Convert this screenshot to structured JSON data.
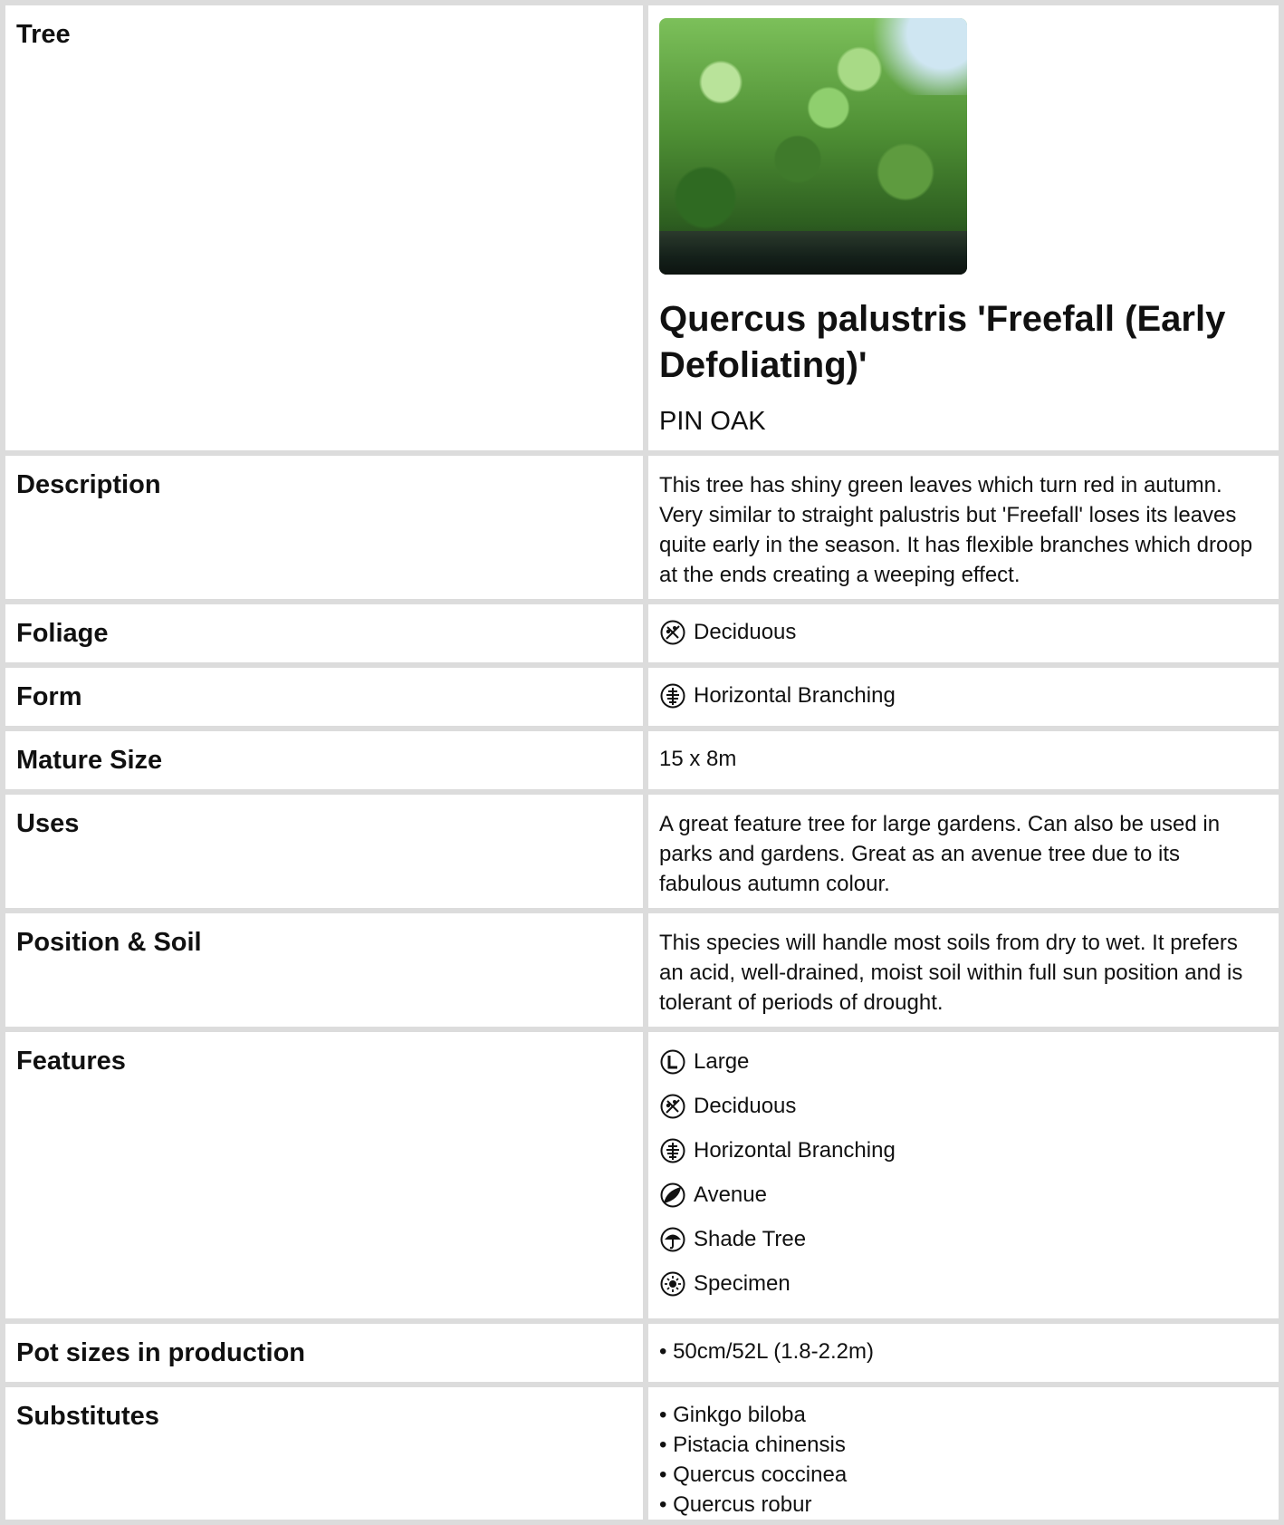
{
  "tree": {
    "label": "Tree",
    "name": "Quercus palustris 'Freefall (Early Defoliating)'",
    "common_name": "PIN OAK"
  },
  "description": {
    "label": "Description",
    "text": "This tree has shiny green leaves which turn red in autumn. Very similar to straight palustris but 'Freefall' loses its leaves quite early in the season. It has flexible branches which droop at the ends creating a weeping effect."
  },
  "foliage": {
    "label": "Foliage",
    "value": "Deciduous",
    "icon": "deciduous-icon"
  },
  "form": {
    "label": "Form",
    "value": "Horizontal Branching",
    "icon": "horizontal-branching-icon"
  },
  "mature_size": {
    "label": "Mature Size",
    "value": "15 x 8m"
  },
  "uses": {
    "label": "Uses",
    "text": "A great feature tree for large gardens. Can also be used in parks and gardens. Great as an avenue tree due to its fabulous autumn colour."
  },
  "position_soil": {
    "label": "Position & Soil",
    "text": "This species will handle most soils from dry to wet. It prefers an acid, well-drained, moist soil within full sun position and is tolerant of periods of drought."
  },
  "features": {
    "label": "Features",
    "items": [
      {
        "label": "Large",
        "icon": "large-icon"
      },
      {
        "label": "Deciduous",
        "icon": "deciduous-icon"
      },
      {
        "label": "Horizontal Branching",
        "icon": "horizontal-branching-icon"
      },
      {
        "label": "Avenue",
        "icon": "avenue-icon"
      },
      {
        "label": "Shade Tree",
        "icon": "shade-tree-icon"
      },
      {
        "label": "Specimen",
        "icon": "specimen-icon"
      }
    ]
  },
  "pot_sizes": {
    "label": "Pot sizes in production",
    "items": [
      "• 50cm/52L (1.8-2.2m)"
    ]
  },
  "substitutes": {
    "label": "Substitutes",
    "items": [
      "• Ginkgo biloba",
      "• Pistacia chinensis",
      "• Quercus coccinea",
      "• Quercus robur"
    ]
  }
}
